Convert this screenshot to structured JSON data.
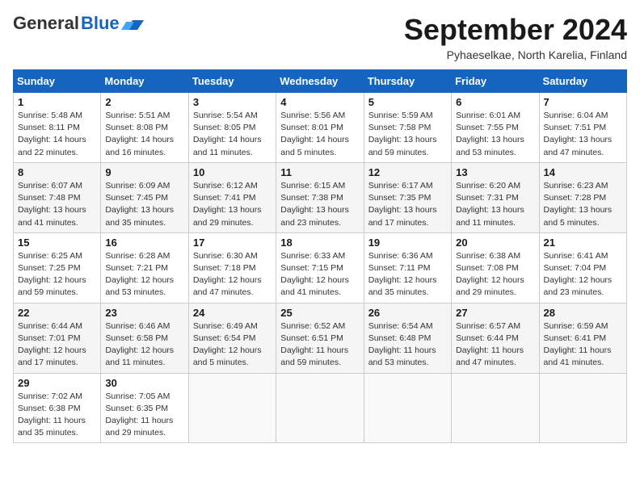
{
  "header": {
    "logo_general": "General",
    "logo_blue": "Blue",
    "month_title": "September 2024",
    "subtitle": "Pyhaeselkae, North Karelia, Finland"
  },
  "days_of_week": [
    "Sunday",
    "Monday",
    "Tuesday",
    "Wednesday",
    "Thursday",
    "Friday",
    "Saturday"
  ],
  "weeks": [
    [
      {
        "day": 1,
        "lines": [
          "Sunrise: 5:48 AM",
          "Sunset: 8:11 PM",
          "Daylight: 14 hours",
          "and 22 minutes."
        ]
      },
      {
        "day": 2,
        "lines": [
          "Sunrise: 5:51 AM",
          "Sunset: 8:08 PM",
          "Daylight: 14 hours",
          "and 16 minutes."
        ]
      },
      {
        "day": 3,
        "lines": [
          "Sunrise: 5:54 AM",
          "Sunset: 8:05 PM",
          "Daylight: 14 hours",
          "and 11 minutes."
        ]
      },
      {
        "day": 4,
        "lines": [
          "Sunrise: 5:56 AM",
          "Sunset: 8:01 PM",
          "Daylight: 14 hours",
          "and 5 minutes."
        ]
      },
      {
        "day": 5,
        "lines": [
          "Sunrise: 5:59 AM",
          "Sunset: 7:58 PM",
          "Daylight: 13 hours",
          "and 59 minutes."
        ]
      },
      {
        "day": 6,
        "lines": [
          "Sunrise: 6:01 AM",
          "Sunset: 7:55 PM",
          "Daylight: 13 hours",
          "and 53 minutes."
        ]
      },
      {
        "day": 7,
        "lines": [
          "Sunrise: 6:04 AM",
          "Sunset: 7:51 PM",
          "Daylight: 13 hours",
          "and 47 minutes."
        ]
      }
    ],
    [
      {
        "day": 8,
        "lines": [
          "Sunrise: 6:07 AM",
          "Sunset: 7:48 PM",
          "Daylight: 13 hours",
          "and 41 minutes."
        ]
      },
      {
        "day": 9,
        "lines": [
          "Sunrise: 6:09 AM",
          "Sunset: 7:45 PM",
          "Daylight: 13 hours",
          "and 35 minutes."
        ]
      },
      {
        "day": 10,
        "lines": [
          "Sunrise: 6:12 AM",
          "Sunset: 7:41 PM",
          "Daylight: 13 hours",
          "and 29 minutes."
        ]
      },
      {
        "day": 11,
        "lines": [
          "Sunrise: 6:15 AM",
          "Sunset: 7:38 PM",
          "Daylight: 13 hours",
          "and 23 minutes."
        ]
      },
      {
        "day": 12,
        "lines": [
          "Sunrise: 6:17 AM",
          "Sunset: 7:35 PM",
          "Daylight: 13 hours",
          "and 17 minutes."
        ]
      },
      {
        "day": 13,
        "lines": [
          "Sunrise: 6:20 AM",
          "Sunset: 7:31 PM",
          "Daylight: 13 hours",
          "and 11 minutes."
        ]
      },
      {
        "day": 14,
        "lines": [
          "Sunrise: 6:23 AM",
          "Sunset: 7:28 PM",
          "Daylight: 13 hours",
          "and 5 minutes."
        ]
      }
    ],
    [
      {
        "day": 15,
        "lines": [
          "Sunrise: 6:25 AM",
          "Sunset: 7:25 PM",
          "Daylight: 12 hours",
          "and 59 minutes."
        ]
      },
      {
        "day": 16,
        "lines": [
          "Sunrise: 6:28 AM",
          "Sunset: 7:21 PM",
          "Daylight: 12 hours",
          "and 53 minutes."
        ]
      },
      {
        "day": 17,
        "lines": [
          "Sunrise: 6:30 AM",
          "Sunset: 7:18 PM",
          "Daylight: 12 hours",
          "and 47 minutes."
        ]
      },
      {
        "day": 18,
        "lines": [
          "Sunrise: 6:33 AM",
          "Sunset: 7:15 PM",
          "Daylight: 12 hours",
          "and 41 minutes."
        ]
      },
      {
        "day": 19,
        "lines": [
          "Sunrise: 6:36 AM",
          "Sunset: 7:11 PM",
          "Daylight: 12 hours",
          "and 35 minutes."
        ]
      },
      {
        "day": 20,
        "lines": [
          "Sunrise: 6:38 AM",
          "Sunset: 7:08 PM",
          "Daylight: 12 hours",
          "and 29 minutes."
        ]
      },
      {
        "day": 21,
        "lines": [
          "Sunrise: 6:41 AM",
          "Sunset: 7:04 PM",
          "Daylight: 12 hours",
          "and 23 minutes."
        ]
      }
    ],
    [
      {
        "day": 22,
        "lines": [
          "Sunrise: 6:44 AM",
          "Sunset: 7:01 PM",
          "Daylight: 12 hours",
          "and 17 minutes."
        ]
      },
      {
        "day": 23,
        "lines": [
          "Sunrise: 6:46 AM",
          "Sunset: 6:58 PM",
          "Daylight: 12 hours",
          "and 11 minutes."
        ]
      },
      {
        "day": 24,
        "lines": [
          "Sunrise: 6:49 AM",
          "Sunset: 6:54 PM",
          "Daylight: 12 hours",
          "and 5 minutes."
        ]
      },
      {
        "day": 25,
        "lines": [
          "Sunrise: 6:52 AM",
          "Sunset: 6:51 PM",
          "Daylight: 11 hours",
          "and 59 minutes."
        ]
      },
      {
        "day": 26,
        "lines": [
          "Sunrise: 6:54 AM",
          "Sunset: 6:48 PM",
          "Daylight: 11 hours",
          "and 53 minutes."
        ]
      },
      {
        "day": 27,
        "lines": [
          "Sunrise: 6:57 AM",
          "Sunset: 6:44 PM",
          "Daylight: 11 hours",
          "and 47 minutes."
        ]
      },
      {
        "day": 28,
        "lines": [
          "Sunrise: 6:59 AM",
          "Sunset: 6:41 PM",
          "Daylight: 11 hours",
          "and 41 minutes."
        ]
      }
    ],
    [
      {
        "day": 29,
        "lines": [
          "Sunrise: 7:02 AM",
          "Sunset: 6:38 PM",
          "Daylight: 11 hours",
          "and 35 minutes."
        ]
      },
      {
        "day": 30,
        "lines": [
          "Sunrise: 7:05 AM",
          "Sunset: 6:35 PM",
          "Daylight: 11 hours",
          "and 29 minutes."
        ]
      },
      null,
      null,
      null,
      null,
      null
    ]
  ]
}
